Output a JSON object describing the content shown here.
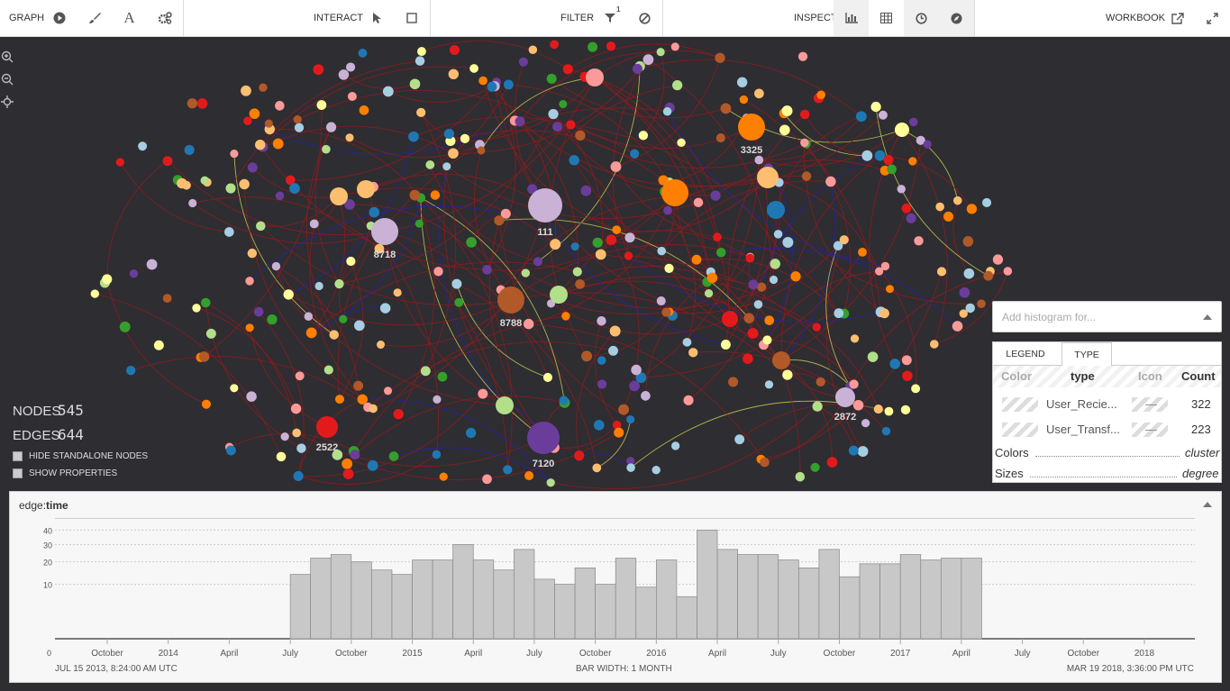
{
  "toolbar": {
    "graph_label": "GRAPH",
    "interact_label": "INTERACT",
    "filter_label": "FILTER",
    "filter_badge": "1",
    "inspect_label": "INSPECT",
    "workbook_label": "WORKBOOK"
  },
  "stats": {
    "nodes_label": "NODES",
    "nodes_value": "545",
    "edges_label": "EDGES",
    "edges_value": "644",
    "hide_standalone_label": "HIDE STANDALONE NODES",
    "show_properties_label": "SHOW PROPERTIES"
  },
  "graph": {
    "node_labels": [
      "3325",
      "111",
      "8718",
      "8788",
      "2522",
      "7120",
      "2872"
    ]
  },
  "histogram_select": {
    "placeholder": "Add histogram for..."
  },
  "legend": {
    "tab_legend": "LEGEND",
    "tab_type": "TYPE",
    "col_color": "Color",
    "col_type": "type",
    "col_icon": "Icon",
    "col_count": "Count",
    "rows": [
      {
        "type": "User_Recie...",
        "icon": "—",
        "count": "322"
      },
      {
        "type": "User_Transf...",
        "icon": "—",
        "count": "223"
      }
    ],
    "colors_label": "Colors",
    "colors_value": "cluster",
    "sizes_label": "Sizes",
    "sizes_value": "degree"
  },
  "histogram": {
    "title_prefix": "edge:",
    "title_attr": "time",
    "start_label": "JUL 15 2013, 8:24:00 AM UTC",
    "bar_width_label": "BAR WIDTH: 1 MONTH",
    "end_label": "MAR 19 2018, 3:36:00 PM UTC"
  },
  "chart_data": {
    "type": "bar",
    "xlabel": "",
    "ylabel": "",
    "y_ticks": [
      "0",
      "10",
      "20",
      "30",
      "40"
    ],
    "ylim": [
      0,
      45
    ],
    "x_tick_labels": [
      "October",
      "2014",
      "April",
      "July",
      "October",
      "2015",
      "April",
      "July",
      "October",
      "2016",
      "April",
      "July",
      "October",
      "2017",
      "April",
      "July",
      "October",
      "2018"
    ],
    "categories": [
      "2014-07",
      "2014-08",
      "2014-09",
      "2014-10",
      "2014-11",
      "2014-12",
      "2015-01",
      "2015-02",
      "2015-03",
      "2015-04",
      "2015-05",
      "2015-06",
      "2015-07",
      "2015-08",
      "2015-09",
      "2015-10",
      "2015-11",
      "2015-12",
      "2016-01",
      "2016-02",
      "2016-03",
      "2016-04",
      "2016-05",
      "2016-06",
      "2016-07",
      "2016-08",
      "2016-09",
      "2016-10",
      "2016-11",
      "2016-12",
      "2017-01",
      "2017-02",
      "2017-03",
      "2017-04"
    ],
    "values": [
      14,
      22,
      24,
      20,
      16,
      14,
      21,
      21,
      30,
      21,
      16,
      27,
      12,
      10,
      17,
      10,
      22,
      9,
      21,
      6,
      40,
      27,
      24,
      24,
      21,
      17,
      27,
      13,
      19,
      19,
      24,
      21,
      22,
      22
    ]
  }
}
